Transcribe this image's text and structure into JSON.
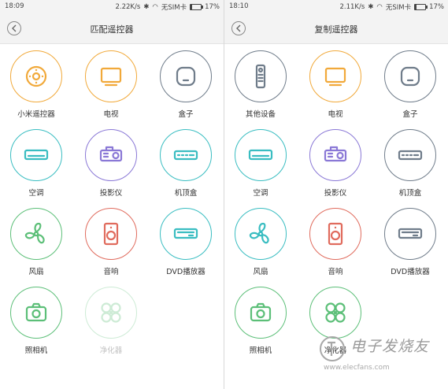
{
  "colors": {
    "orange": "#f1a93a",
    "gray": "#6f7c8a",
    "teal": "#39bdc1",
    "purple": "#8a78d6",
    "green": "#5cbf78",
    "red": "#e06b5d"
  },
  "screens": [
    {
      "status": {
        "time": "18:09",
        "speed": "2.22K/s",
        "sim": "无SIM卡",
        "battery": "17%",
        "battery_level": 0.17
      },
      "title": "匹配遥控器",
      "items": [
        {
          "label": "小米遥控器",
          "icon": "mi-remote-icon",
          "color": "orange",
          "disabled": false
        },
        {
          "label": "电视",
          "icon": "tv-icon",
          "color": "orange",
          "disabled": false
        },
        {
          "label": "盒子",
          "icon": "box-icon",
          "color": "gray",
          "disabled": false
        },
        {
          "label": "空调",
          "icon": "air-conditioner-icon",
          "color": "teal",
          "disabled": false
        },
        {
          "label": "投影仪",
          "icon": "projector-icon",
          "color": "purple",
          "disabled": false
        },
        {
          "label": "机顶盒",
          "icon": "set-top-box-icon",
          "color": "teal",
          "disabled": false
        },
        {
          "label": "风扇",
          "icon": "fan-icon",
          "color": "green",
          "disabled": false
        },
        {
          "label": "音响",
          "icon": "speaker-icon",
          "color": "red",
          "disabled": false
        },
        {
          "label": "DVD播放器",
          "icon": "dvd-player-icon",
          "color": "teal",
          "disabled": false
        },
        {
          "label": "照相机",
          "icon": "camera-icon",
          "color": "green",
          "disabled": false
        },
        {
          "label": "净化器",
          "icon": "purifier-icon",
          "color": "green",
          "disabled": true
        }
      ]
    },
    {
      "status": {
        "time": "18:10",
        "speed": "2.11K/s",
        "sim": "无SIM卡",
        "battery": "17%",
        "battery_level": 0.17
      },
      "title": "复制遥控器",
      "items": [
        {
          "label": "其他设备",
          "icon": "generic-remote-icon",
          "color": "gray",
          "disabled": false
        },
        {
          "label": "电视",
          "icon": "tv-icon",
          "color": "orange",
          "disabled": false
        },
        {
          "label": "盒子",
          "icon": "box-icon",
          "color": "gray",
          "disabled": false
        },
        {
          "label": "空调",
          "icon": "air-conditioner-icon",
          "color": "teal",
          "disabled": false
        },
        {
          "label": "投影仪",
          "icon": "projector-icon",
          "color": "purple",
          "disabled": false
        },
        {
          "label": "机顶盒",
          "icon": "set-top-box-icon",
          "color": "gray",
          "disabled": false
        },
        {
          "label": "风扇",
          "icon": "fan-icon",
          "color": "teal",
          "disabled": false
        },
        {
          "label": "音响",
          "icon": "speaker-icon",
          "color": "red",
          "disabled": false
        },
        {
          "label": "DVD播放器",
          "icon": "dvd-player-icon",
          "color": "gray",
          "disabled": false
        },
        {
          "label": "照相机",
          "icon": "camera-icon",
          "color": "green",
          "disabled": false
        },
        {
          "label": "净化器",
          "icon": "purifier-icon",
          "color": "green",
          "disabled": false
        }
      ]
    }
  ],
  "watermark": {
    "text": "电子发烧友",
    "url": "www.elecfans.com"
  }
}
